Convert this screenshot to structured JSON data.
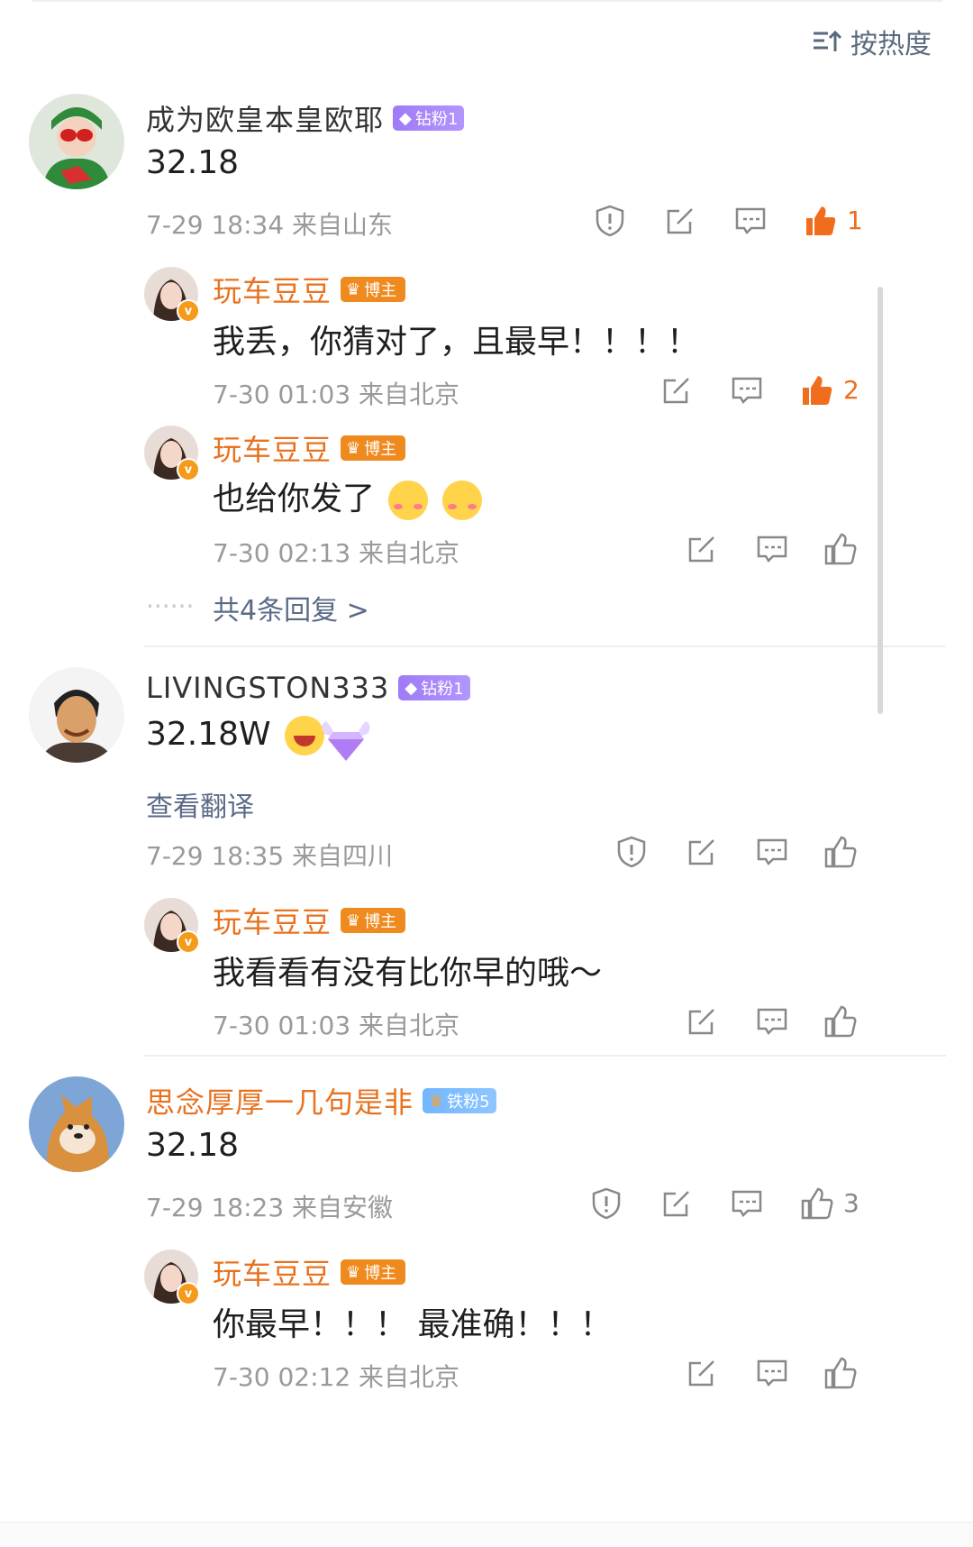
{
  "sort": {
    "label": "按热度",
    "icon": "sort-icon"
  },
  "comments": [
    {
      "name": "成为欧皇本皇欧耶",
      "badge": "钻粉1",
      "text": "32.18",
      "meta": "7-29 18:34 来自山东",
      "likes": "1",
      "replies": [
        {
          "name": "玩车豆豆",
          "badge": "博主",
          "text": "我丢，你猜对了，且最早！！！！",
          "meta": "7-30 01:03 来自北京",
          "likes": "2"
        },
        {
          "name": "玩车豆豆",
          "badge": "博主",
          "text": "也给你发了",
          "meta": "7-30 02:13 来自北京",
          "likes": ""
        }
      ],
      "more_replies": "共4条回复 >"
    },
    {
      "name": "LIVINGSTON333",
      "badge": "钻粉1",
      "text": "32.18W",
      "translate": "查看翻译",
      "meta": "7-29 18:35 来自四川",
      "likes": "",
      "replies": [
        {
          "name": "玩车豆豆",
          "badge": "博主",
          "text": "我看看有没有比你早的哦～",
          "meta": "7-30 01:03 来自北京",
          "likes": ""
        }
      ]
    },
    {
      "name": "思念厚厚一几句是非",
      "badge": "铁粉5",
      "text": "32.18",
      "meta": "7-29 18:23 来自安徽",
      "likes": "3",
      "replies": [
        {
          "name": "玩车豆豆",
          "badge": "博主",
          "text": "你最早！！！ 最准确！！！",
          "meta": "7-30 02:12 来自北京",
          "likes": ""
        }
      ]
    }
  ],
  "colors": {
    "accent_orange": "#e8721f",
    "like_active": "#f06d1e",
    "link_blue": "#5b6b87",
    "diamond_purple": "#9f7bf5"
  }
}
